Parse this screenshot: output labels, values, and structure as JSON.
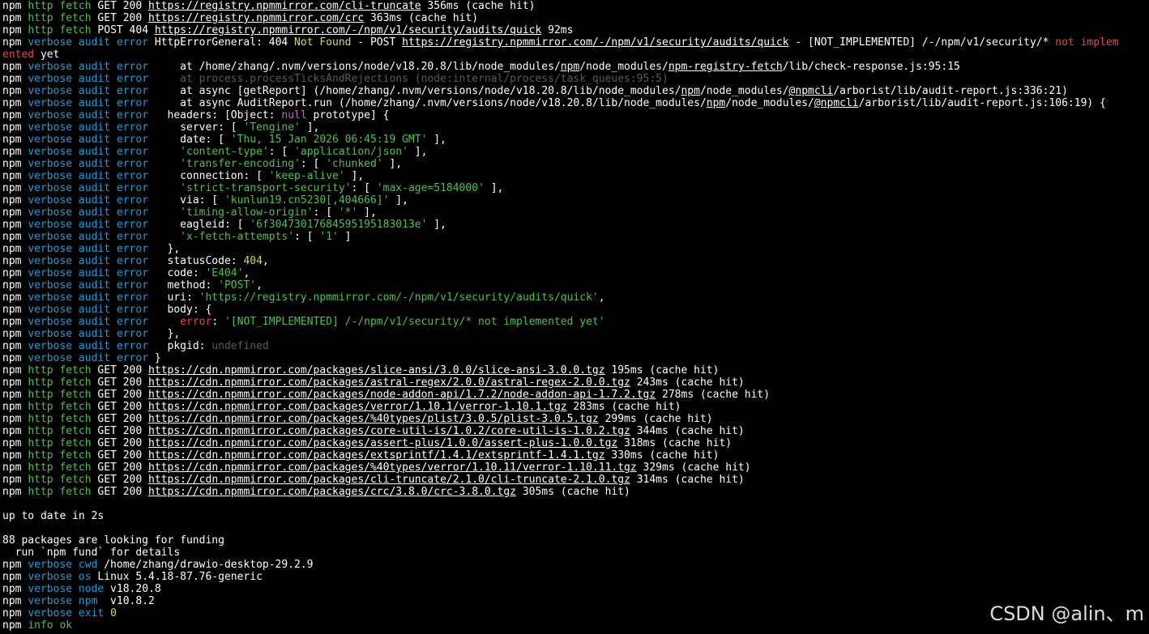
{
  "colors": {
    "background": "#000000",
    "text": "#ffffff",
    "http_green": "#4ec14e",
    "verbose_blue": "#1e9cd8",
    "number_yellow": "#d7d75f",
    "error_red": "#e34b4b",
    "null_magenta": "#d35fd3",
    "undefined_gray": "#5a5a5a"
  },
  "terminal": {
    "lines": [
      [
        [
          "npm ",
          "w"
        ],
        [
          "http fetch",
          "g"
        ],
        [
          " GET 200 ",
          "w"
        ],
        [
          "https://registry.npmmirror.com/cli-truncate",
          "w",
          "u"
        ],
        [
          " 356ms (cache hit)",
          "w"
        ]
      ],
      [
        [
          "npm ",
          "w"
        ],
        [
          "http fetch",
          "g"
        ],
        [
          " GET 200 ",
          "w"
        ],
        [
          "https://registry.npmmirror.com/crc",
          "w",
          "u"
        ],
        [
          " 363ms (cache hit)",
          "w"
        ]
      ],
      [
        [
          "npm ",
          "w"
        ],
        [
          "http fetch",
          "g"
        ],
        [
          " POST 404 ",
          "w"
        ],
        [
          "https://registry.npmmirror.com/-/npm/v1/security/audits/quick",
          "w",
          "u"
        ],
        [
          " 92ms",
          "w"
        ]
      ],
      [
        [
          "npm ",
          "w"
        ],
        [
          "verbose audit error",
          "b"
        ],
        [
          " HttpErrorGeneral: 404 ",
          "w"
        ],
        [
          "Not Found",
          "y"
        ],
        [
          " - POST ",
          "w"
        ],
        [
          "https://registry.npmmirror.com/-/npm/v1/security/audits/quick",
          "w",
          "u"
        ],
        [
          " - [NOT_IMPLEMENTED] /-/npm/v1/security/* ",
          "w"
        ],
        [
          "not implem",
          "r"
        ]
      ],
      [
        [
          "ented",
          "r"
        ],
        [
          " yet",
          "w"
        ]
      ],
      [
        [
          "npm ",
          "w"
        ],
        [
          "verbose audit error",
          "b"
        ],
        [
          "     at /home/zhang/.nvm/versions/node/v18.20.8/lib/node_modules/",
          "w"
        ],
        [
          "npm",
          "w",
          "u"
        ],
        [
          "/node_modules/",
          "w"
        ],
        [
          "npm-registry-fetch",
          "w",
          "u"
        ],
        [
          "/lib/check-response.js:95:15",
          "w"
        ]
      ],
      [
        [
          "npm ",
          "w"
        ],
        [
          "verbose audit error",
          "b"
        ],
        [
          "     at process.processTicksAndRejections (node:internal/process/task_queues:95:5)",
          "d"
        ]
      ],
      [
        [
          "npm ",
          "w"
        ],
        [
          "verbose audit error",
          "b"
        ],
        [
          "     at async [getReport] (/home/zhang/.nvm/versions/node/v18.20.8/lib/node_modules/",
          "w"
        ],
        [
          "npm",
          "w",
          "u"
        ],
        [
          "/node_modules/",
          "w"
        ],
        [
          "@npmcli",
          "w",
          "u"
        ],
        [
          "/arborist/lib/audit-report.js:336:21)",
          "w"
        ]
      ],
      [
        [
          "npm ",
          "w"
        ],
        [
          "verbose audit error",
          "b"
        ],
        [
          "     at async AuditReport.run (/home/zhang/.nvm/versions/node/v18.20.8/lib/node_modules/",
          "w"
        ],
        [
          "npm",
          "w",
          "u"
        ],
        [
          "/node_modules/",
          "w"
        ],
        [
          "@npmcli",
          "w",
          "u"
        ],
        [
          "/arborist/lib/audit-report.js:106:19) {",
          "w"
        ]
      ],
      [
        [
          "npm ",
          "w"
        ],
        [
          "verbose audit error",
          "b"
        ],
        [
          "   headers: [Object: ",
          "w"
        ],
        [
          "null",
          "m"
        ],
        [
          " prototype] {",
          "w"
        ]
      ],
      [
        [
          "npm ",
          "w"
        ],
        [
          "verbose audit error",
          "b"
        ],
        [
          "     server: [ ",
          "w"
        ],
        [
          "'Tengine'",
          "g"
        ],
        [
          " ],",
          "w"
        ]
      ],
      [
        [
          "npm ",
          "w"
        ],
        [
          "verbose audit error",
          "b"
        ],
        [
          "     date: [ ",
          "w"
        ],
        [
          "'Thu, 15 Jan 2026 06:45:19 GMT'",
          "g"
        ],
        [
          " ],",
          "w"
        ]
      ],
      [
        [
          "npm ",
          "w"
        ],
        [
          "verbose audit error",
          "b"
        ],
        [
          "     ",
          "w"
        ],
        [
          "'content-type'",
          "g"
        ],
        [
          ": [ ",
          "w"
        ],
        [
          "'application/json'",
          "g"
        ],
        [
          " ],",
          "w"
        ]
      ],
      [
        [
          "npm ",
          "w"
        ],
        [
          "verbose audit error",
          "b"
        ],
        [
          "     ",
          "w"
        ],
        [
          "'transfer-encoding'",
          "g"
        ],
        [
          ": [ ",
          "w"
        ],
        [
          "'chunked'",
          "g"
        ],
        [
          " ],",
          "w"
        ]
      ],
      [
        [
          "npm ",
          "w"
        ],
        [
          "verbose audit error",
          "b"
        ],
        [
          "     connection: [ ",
          "w"
        ],
        [
          "'keep-alive'",
          "g"
        ],
        [
          " ],",
          "w"
        ]
      ],
      [
        [
          "npm ",
          "w"
        ],
        [
          "verbose audit error",
          "b"
        ],
        [
          "     ",
          "w"
        ],
        [
          "'strict-transport-security'",
          "g"
        ],
        [
          ": [ ",
          "w"
        ],
        [
          "'max-age=5184000'",
          "g"
        ],
        [
          " ],",
          "w"
        ]
      ],
      [
        [
          "npm ",
          "w"
        ],
        [
          "verbose audit error",
          "b"
        ],
        [
          "     via: [ ",
          "w"
        ],
        [
          "'kunlun19.cn5230[,404666]'",
          "g"
        ],
        [
          " ],",
          "w"
        ]
      ],
      [
        [
          "npm ",
          "w"
        ],
        [
          "verbose audit error",
          "b"
        ],
        [
          "     ",
          "w"
        ],
        [
          "'timing-allow-origin'",
          "g"
        ],
        [
          ": [ ",
          "w"
        ],
        [
          "'*'",
          "g"
        ],
        [
          " ],",
          "w"
        ]
      ],
      [
        [
          "npm ",
          "w"
        ],
        [
          "verbose audit error",
          "b"
        ],
        [
          "     eagleid: [ ",
          "w"
        ],
        [
          "'6f30473017684595195183013e'",
          "g"
        ],
        [
          " ],",
          "w"
        ]
      ],
      [
        [
          "npm ",
          "w"
        ],
        [
          "verbose audit error",
          "b"
        ],
        [
          "     ",
          "w"
        ],
        [
          "'x-fetch-attempts'",
          "g"
        ],
        [
          ": [ ",
          "w"
        ],
        [
          "'1'",
          "g"
        ],
        [
          " ]",
          "w"
        ]
      ],
      [
        [
          "npm ",
          "w"
        ],
        [
          "verbose audit error",
          "b"
        ],
        [
          "   },",
          "w"
        ]
      ],
      [
        [
          "npm ",
          "w"
        ],
        [
          "verbose audit error",
          "b"
        ],
        [
          "   statusCode: ",
          "w"
        ],
        [
          "404",
          "y"
        ],
        [
          ",",
          "w"
        ]
      ],
      [
        [
          "npm ",
          "w"
        ],
        [
          "verbose audit error",
          "b"
        ],
        [
          "   code: ",
          "w"
        ],
        [
          "'E404'",
          "g"
        ],
        [
          ",",
          "w"
        ]
      ],
      [
        [
          "npm ",
          "w"
        ],
        [
          "verbose audit error",
          "b"
        ],
        [
          "   method: ",
          "w"
        ],
        [
          "'POST'",
          "g"
        ],
        [
          ",",
          "w"
        ]
      ],
      [
        [
          "npm ",
          "w"
        ],
        [
          "verbose audit error",
          "b"
        ],
        [
          "   uri: ",
          "w"
        ],
        [
          "'https://registry.npmmirror.com/-/npm/v1/security/audits/quick'",
          "g"
        ],
        [
          ",",
          "w"
        ]
      ],
      [
        [
          "npm ",
          "w"
        ],
        [
          "verbose audit error",
          "b"
        ],
        [
          "   body: {",
          "w"
        ]
      ],
      [
        [
          "npm ",
          "w"
        ],
        [
          "verbose audit error",
          "b"
        ],
        [
          "     ",
          "w"
        ],
        [
          "error",
          "r"
        ],
        [
          ": ",
          "w"
        ],
        [
          "'[NOT_IMPLEMENTED] /-/npm/v1/security/* not implemented yet'",
          "g"
        ]
      ],
      [
        [
          "npm ",
          "w"
        ],
        [
          "verbose audit error",
          "b"
        ],
        [
          "   },",
          "w"
        ]
      ],
      [
        [
          "npm ",
          "w"
        ],
        [
          "verbose audit error",
          "b"
        ],
        [
          "   pkgid: ",
          "w"
        ],
        [
          "undefined",
          "d"
        ]
      ],
      [
        [
          "npm ",
          "w"
        ],
        [
          "verbose audit error",
          "b"
        ],
        [
          " }",
          "w"
        ]
      ],
      [
        [
          "npm ",
          "w"
        ],
        [
          "http fetch",
          "g"
        ],
        [
          " GET 200 ",
          "w"
        ],
        [
          "https://cdn.npmmirror.com/packages/slice-ansi/3.0.0/slice-ansi-3.0.0.tgz",
          "w",
          "u"
        ],
        [
          " 195ms (cache hit)",
          "w"
        ]
      ],
      [
        [
          "npm ",
          "w"
        ],
        [
          "http fetch",
          "g"
        ],
        [
          " GET 200 ",
          "w"
        ],
        [
          "https://cdn.npmmirror.com/packages/astral-regex/2.0.0/astral-regex-2.0.0.tgz",
          "w",
          "u"
        ],
        [
          " 243ms (cache hit)",
          "w"
        ]
      ],
      [
        [
          "npm ",
          "w"
        ],
        [
          "http fetch",
          "g"
        ],
        [
          " GET 200 ",
          "w"
        ],
        [
          "https://cdn.npmmirror.com/packages/node-addon-api/1.7.2/node-addon-api-1.7.2.tgz",
          "w",
          "u"
        ],
        [
          " 278ms (cache hit)",
          "w"
        ]
      ],
      [
        [
          "npm ",
          "w"
        ],
        [
          "http fetch",
          "g"
        ],
        [
          " GET 200 ",
          "w"
        ],
        [
          "https://cdn.npmmirror.com/packages/verror/1.10.1/verror-1.10.1.tgz",
          "w",
          "u"
        ],
        [
          " 283ms (cache hit)",
          "w"
        ]
      ],
      [
        [
          "npm ",
          "w"
        ],
        [
          "http fetch",
          "g"
        ],
        [
          " GET 200 ",
          "w"
        ],
        [
          "https://cdn.npmmirror.com/packages/%40types/plist/3.0.5/plist-3.0.5.tgz",
          "w",
          "u"
        ],
        [
          " 299ms (cache hit)",
          "w"
        ]
      ],
      [
        [
          "npm ",
          "w"
        ],
        [
          "http fetch",
          "g"
        ],
        [
          " GET 200 ",
          "w"
        ],
        [
          "https://cdn.npmmirror.com/packages/core-util-is/1.0.2/core-util-is-1.0.2.tgz",
          "w",
          "u"
        ],
        [
          " 344ms (cache hit)",
          "w"
        ]
      ],
      [
        [
          "npm ",
          "w"
        ],
        [
          "http fetch",
          "g"
        ],
        [
          " GET 200 ",
          "w"
        ],
        [
          "https://cdn.npmmirror.com/packages/assert-plus/1.0.0/assert-plus-1.0.0.tgz",
          "w",
          "u"
        ],
        [
          " 318ms (cache hit)",
          "w"
        ]
      ],
      [
        [
          "npm ",
          "w"
        ],
        [
          "http fetch",
          "g"
        ],
        [
          " GET 200 ",
          "w"
        ],
        [
          "https://cdn.npmmirror.com/packages/extsprintf/1.4.1/extsprintf-1.4.1.tgz",
          "w",
          "u"
        ],
        [
          " 330ms (cache hit)",
          "w"
        ]
      ],
      [
        [
          "npm ",
          "w"
        ],
        [
          "http fetch",
          "g"
        ],
        [
          " GET 200 ",
          "w"
        ],
        [
          "https://cdn.npmmirror.com/packages/%40types/verror/1.10.11/verror-1.10.11.tgz",
          "w",
          "u"
        ],
        [
          " 329ms (cache hit)",
          "w"
        ]
      ],
      [
        [
          "npm ",
          "w"
        ],
        [
          "http fetch",
          "g"
        ],
        [
          " GET 200 ",
          "w"
        ],
        [
          "https://cdn.npmmirror.com/packages/cli-truncate/2.1.0/cli-truncate-2.1.0.tgz",
          "w",
          "u"
        ],
        [
          " 314ms (cache hit)",
          "w"
        ]
      ],
      [
        [
          "npm ",
          "w"
        ],
        [
          "http fetch",
          "g"
        ],
        [
          " GET 200 ",
          "w"
        ],
        [
          "https://cdn.npmmirror.com/packages/crc/3.8.0/crc-3.8.0.tgz",
          "w",
          "u"
        ],
        [
          " 305ms (cache hit)",
          "w"
        ]
      ],
      [],
      [
        [
          "up to date in 2s",
          "w"
        ]
      ],
      [],
      [
        [
          "88 packages are looking for funding",
          "w"
        ]
      ],
      [
        [
          "  run `npm fund` for details",
          "w"
        ]
      ],
      [
        [
          "npm ",
          "w"
        ],
        [
          "verbose cwd",
          "b"
        ],
        [
          " /home/zhang/drawio-desktop-29.2.9",
          "w"
        ]
      ],
      [
        [
          "npm ",
          "w"
        ],
        [
          "verbose os",
          "b"
        ],
        [
          " Linux 5.4.18-87.76-generic",
          "w"
        ]
      ],
      [
        [
          "npm ",
          "w"
        ],
        [
          "verbose node",
          "b"
        ],
        [
          " v18.20.8",
          "w"
        ]
      ],
      [
        [
          "npm ",
          "w"
        ],
        [
          "verbose npm",
          "b"
        ],
        [
          "  v10.8.2",
          "w"
        ]
      ],
      [
        [
          "npm ",
          "w"
        ],
        [
          "verbose exit",
          "b"
        ],
        [
          " ",
          "w"
        ],
        [
          "0",
          "y"
        ]
      ],
      [
        [
          "npm ",
          "w"
        ],
        [
          "info ok",
          "g"
        ]
      ]
    ]
  },
  "watermark": "CSDN @alin、m"
}
